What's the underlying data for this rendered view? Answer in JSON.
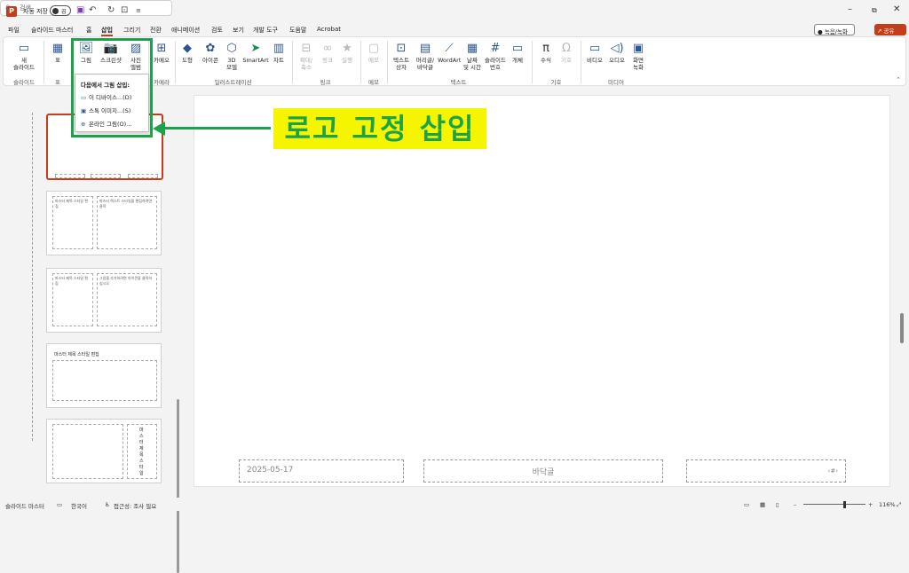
{
  "titlebar": {
    "logo": "P",
    "autosave_label": "자동 저장",
    "autosave_state": "끔",
    "search_placeholder": "검색",
    "quick_access": [
      "save-icon",
      "undo-icon",
      "redo-icon",
      "present-icon",
      "customize-icon"
    ]
  },
  "menu": {
    "items": [
      "파일",
      "슬라이드 마스터",
      "홈",
      "삽입",
      "그리기",
      "전환",
      "애니메이션",
      "검토",
      "보기",
      "개발 도구",
      "도움말",
      "Acrobat"
    ],
    "active": "삽입",
    "record_label": "녹음/녹화",
    "share_label": "공유"
  },
  "ribbon": {
    "buttons": {
      "new_slide": "새\n슬라이드",
      "table": "표",
      "picture": "그림",
      "screenshot": "스크린샷",
      "photo_album": "사진\n앨범",
      "camera": "카메오",
      "shapes": "도형",
      "icons": "아이콘",
      "models3d": "3D\n모델",
      "smartart": "SmartArt",
      "chart": "차트",
      "zoom": "확대/\n축소",
      "link": "링크",
      "action": "실행",
      "comment": "메모",
      "textbox": "텍스트\n상자",
      "header_footer": "머리글/\n바닥글",
      "wordart": "WordArt",
      "date_time": "날짜\n및 시간",
      "slide_number": "슬라이드\n번호",
      "object": "개체",
      "equation": "수식",
      "symbol": "기호",
      "video": "비디오",
      "audio": "오디오",
      "screen_recording": "화면\n녹화"
    },
    "groups": {
      "slides": "슬라이드",
      "tables": "표",
      "camera": "카메라",
      "illustrations": "일러스트레이션",
      "links": "링크",
      "comments": "메모",
      "text": "텍스트",
      "symbols": "기호",
      "media": "미디어"
    }
  },
  "dropdown": {
    "header": "다음에서 그림 삽입:",
    "items": [
      "이 디바이스...(D)",
      "스톡 이미지...(S)",
      "온라인 그림(O)..."
    ]
  },
  "thumbnails": {
    "t3_title": "마스터 제목 스타일 편집",
    "t3_body": "마스터 텍스트 스타일을 편집하려면 클릭",
    "t4_title": "마스터 제목 스타일 편집",
    "t4_body": "그림을 추가하려면 아이콘을 클릭하십시오",
    "t5_title": "마스터 제목 스타일 편집",
    "t6_title": "마스터 제목 스타일"
  },
  "slide": {
    "date": "2025-05-17",
    "footer": "바닥글",
    "page_number": "‹#›"
  },
  "annotation": {
    "callout": "로고 고정 삽입",
    "color": "#1aa34a",
    "highlight": "#f5f500"
  },
  "statusbar": {
    "view": "슬라이드 마스터",
    "language": "한국어",
    "accessibility": "접근성: 조사 필요",
    "zoom": "116%"
  },
  "colors": {
    "accent": "#c43e1c",
    "icon": "#2b5797"
  }
}
